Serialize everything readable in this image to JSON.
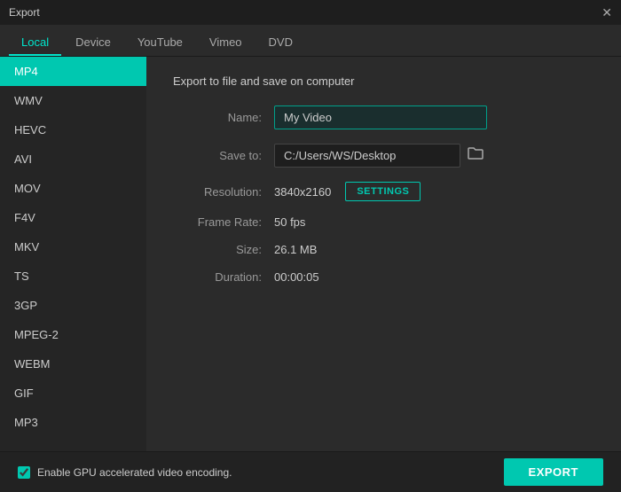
{
  "titleBar": {
    "title": "Export",
    "closeLabel": "✕"
  },
  "tabs": [
    {
      "id": "local",
      "label": "Local",
      "active": true
    },
    {
      "id": "device",
      "label": "Device",
      "active": false
    },
    {
      "id": "youtube",
      "label": "YouTube",
      "active": false
    },
    {
      "id": "vimeo",
      "label": "Vimeo",
      "active": false
    },
    {
      "id": "dvd",
      "label": "DVD",
      "active": false
    }
  ],
  "sidebar": {
    "items": [
      {
        "id": "mp4",
        "label": "MP4",
        "active": true
      },
      {
        "id": "wmv",
        "label": "WMV",
        "active": false
      },
      {
        "id": "hevc",
        "label": "HEVC",
        "active": false
      },
      {
        "id": "avi",
        "label": "AVI",
        "active": false
      },
      {
        "id": "mov",
        "label": "MOV",
        "active": false
      },
      {
        "id": "f4v",
        "label": "F4V",
        "active": false
      },
      {
        "id": "mkv",
        "label": "MKV",
        "active": false
      },
      {
        "id": "ts",
        "label": "TS",
        "active": false
      },
      {
        "id": "3gp",
        "label": "3GP",
        "active": false
      },
      {
        "id": "mpeg2",
        "label": "MPEG-2",
        "active": false
      },
      {
        "id": "webm",
        "label": "WEBM",
        "active": false
      },
      {
        "id": "gif",
        "label": "GIF",
        "active": false
      },
      {
        "id": "mp3",
        "label": "MP3",
        "active": false
      }
    ]
  },
  "content": {
    "sectionTitle": "Export to file and save on computer",
    "fields": {
      "name": {
        "label": "Name:",
        "value": "My Video",
        "placeholder": "My Video"
      },
      "saveTo": {
        "label": "Save to:",
        "path": "C:/Users/WS/Desktop"
      },
      "resolution": {
        "label": "Resolution:",
        "value": "3840x2160",
        "settingsLabel": "SETTINGS"
      },
      "frameRate": {
        "label": "Frame Rate:",
        "value": "50 fps"
      },
      "size": {
        "label": "Size:",
        "value": "26.1 MB"
      },
      "duration": {
        "label": "Duration:",
        "value": "00:00:05"
      }
    }
  },
  "footer": {
    "checkboxLabel": "Enable GPU accelerated video encoding.",
    "exportLabel": "EXPORT"
  }
}
